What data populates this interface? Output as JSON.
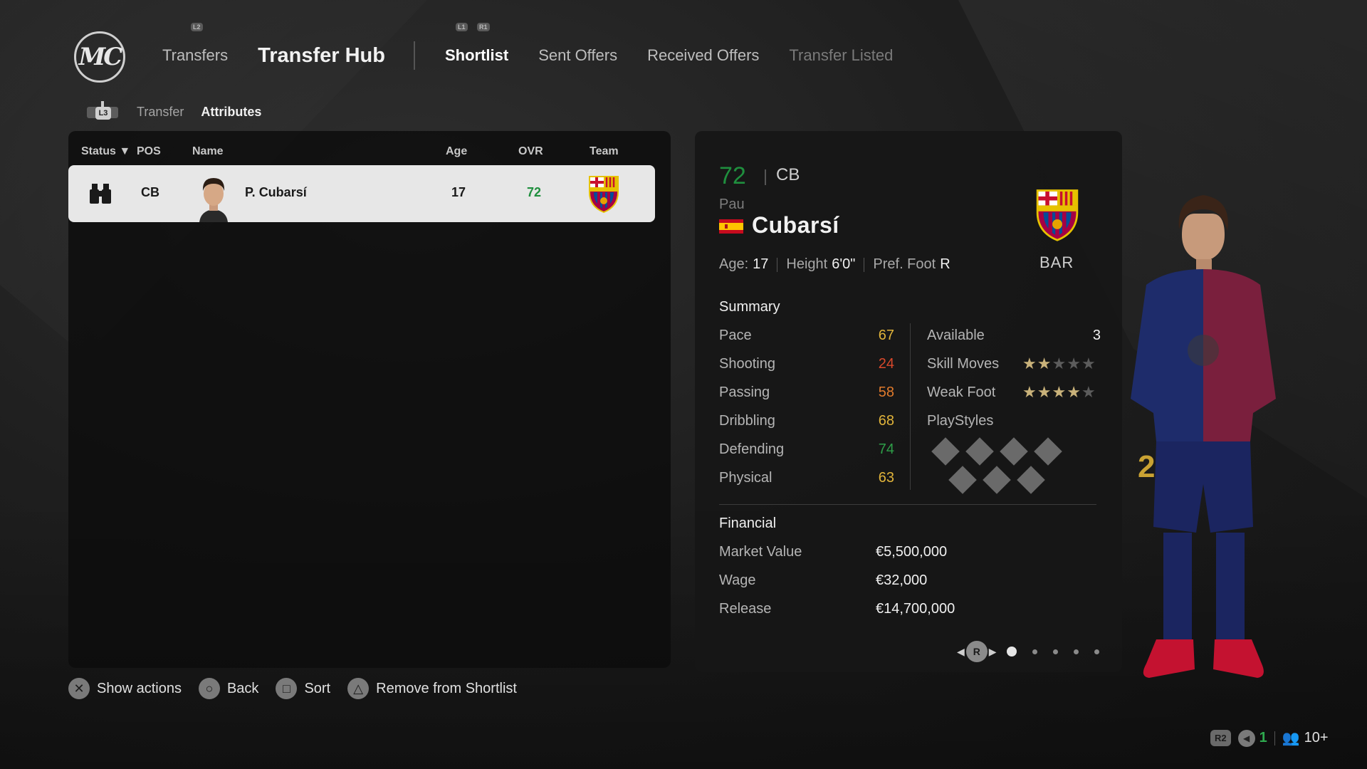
{
  "nav": {
    "logo": "MC",
    "transfers": "Transfers",
    "hub_title": "Transfer Hub",
    "tabs": [
      {
        "label": "Shortlist",
        "state": "active"
      },
      {
        "label": "Sent Offers",
        "state": "normal"
      },
      {
        "label": "Received Offers",
        "state": "normal"
      },
      {
        "label": "Transfer Listed",
        "state": "disabled"
      }
    ],
    "hints": {
      "l2": "L2",
      "l1": "L1",
      "r1": "R1"
    }
  },
  "breadcrumb": {
    "stick_hint": "L3",
    "item1": "Transfer",
    "item2": "Attributes"
  },
  "list": {
    "headers": {
      "status": "Status ▼",
      "pos": "POS",
      "name": "Name",
      "age": "Age",
      "ovr": "OVR",
      "team": "Team"
    },
    "rows": [
      {
        "status_icon": "binoculars-icon",
        "pos": "CB",
        "name": "P. Cubarsí",
        "age": "17",
        "ovr": "72",
        "team_crest": "fcb-crest"
      }
    ]
  },
  "detail": {
    "ovr": "72",
    "pos": "CB",
    "first_name": "Pau",
    "last_name": "Cubarsí",
    "nationality_flag": "spain-flag",
    "team_abbr": "BAR",
    "age_label": "Age:",
    "age": "17",
    "height_label": "Height",
    "height": "6'0\"",
    "foot_label": "Pref. Foot",
    "foot": "R",
    "summary_title": "Summary",
    "stats": [
      {
        "label": "Pace",
        "value": "67",
        "color": "#e0b33a"
      },
      {
        "label": "Shooting",
        "value": "24",
        "color": "#d9482b"
      },
      {
        "label": "Passing",
        "value": "58",
        "color": "#e07a2c"
      },
      {
        "label": "Dribbling",
        "value": "68",
        "color": "#e0b33a"
      },
      {
        "label": "Defending",
        "value": "74",
        "color": "#2e9e48"
      },
      {
        "label": "Physical",
        "value": "63",
        "color": "#e0b33a"
      }
    ],
    "available_label": "Available",
    "available_value": "3",
    "skill_moves_label": "Skill Moves",
    "skill_moves_stars": 2,
    "weak_foot_label": "Weak Foot",
    "weak_foot_stars": 4,
    "playstyles_label": "PlayStyles",
    "playstyles_count": 7,
    "financial_title": "Financial",
    "financial": [
      {
        "label": "Market Value",
        "value": "€5,500,000"
      },
      {
        "label": "Wage",
        "value": "€32,000"
      },
      {
        "label": "Release",
        "value": "€14,700,000"
      }
    ],
    "pager": {
      "button": "R",
      "pages": 5,
      "current": 1
    }
  },
  "actions": [
    {
      "icon": "cross-button-icon",
      "glyph": "✕",
      "label": "Show actions"
    },
    {
      "icon": "circle-button-icon",
      "glyph": "○",
      "label": "Back"
    },
    {
      "icon": "square-button-icon",
      "glyph": "□",
      "label": "Sort"
    },
    {
      "icon": "triangle-button-icon",
      "glyph": "△",
      "label": "Remove from Shortlist"
    }
  ],
  "tray": {
    "r2": "R2",
    "count": "1",
    "players": "10+"
  },
  "colors": {
    "ovr_green": "#1f8f3e",
    "accent_green": "#1fa64a",
    "star_on": "#c9b27a"
  }
}
